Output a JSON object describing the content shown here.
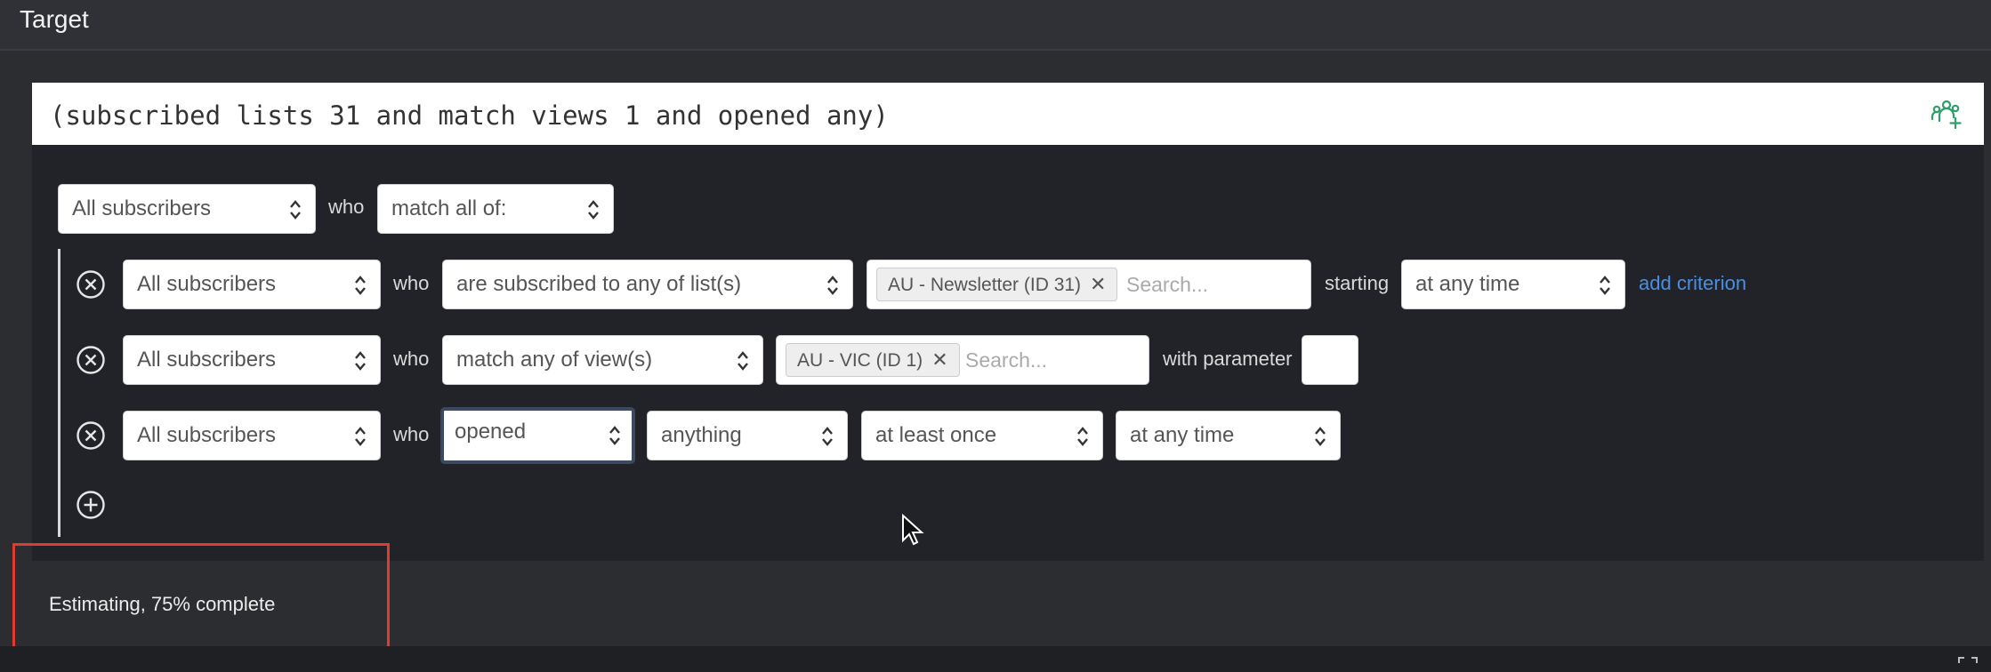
{
  "header": {
    "title": "Target"
  },
  "query": {
    "text": "(subscribed lists 31 and match views 1 and opened any)",
    "group_icon": "user-group-add-icon"
  },
  "top_row": {
    "audience": "All subscribers",
    "who": "who",
    "match": "match all of:"
  },
  "criteria": [
    {
      "audience": "All subscribers",
      "who": "who",
      "condition": "are subscribed to any of list(s)",
      "tag": "AU - Newsletter (ID 31)",
      "search_placeholder": "Search...",
      "starting_label": "starting",
      "time": "at any time",
      "add_link": "add criterion"
    },
    {
      "audience": "All subscribers",
      "who": "who",
      "condition": "match any of view(s)",
      "tag": "AU - VIC (ID 1)",
      "search_placeholder": "Search...",
      "param_label": "with parameter"
    },
    {
      "audience": "All subscribers",
      "who": "who",
      "condition": "opened",
      "what": "anything",
      "frequency": "at least once",
      "time": "at any time"
    }
  ],
  "status": {
    "text": "Estimating, 75% complete"
  },
  "colors": {
    "link": "#4a90e2",
    "highlight": "#e03b2f",
    "accent_icon": "#2e9e6a"
  }
}
